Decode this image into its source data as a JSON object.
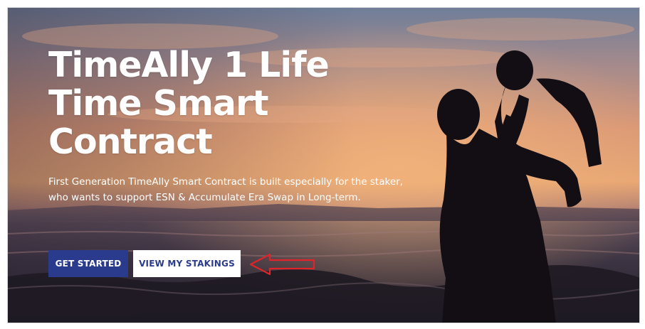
{
  "hero": {
    "headline_lines": [
      "TimeAlly 1 Life",
      "Time Smart",
      "Contract"
    ],
    "description": "First Generation TimeAlly Smart Contract is built especially for the staker, who wants to support ESN & Accumulate Era Swap in Long-term."
  },
  "buttons": {
    "get_started": "GET STARTED",
    "view_stakings": "VIEW MY STAKINGS"
  },
  "colors": {
    "primary_button": "#2a3a8c",
    "secondary_button_bg": "#ffffff",
    "annotation_arrow": "#e0242b"
  },
  "icons": {
    "annotation": "arrow-left-icon"
  }
}
